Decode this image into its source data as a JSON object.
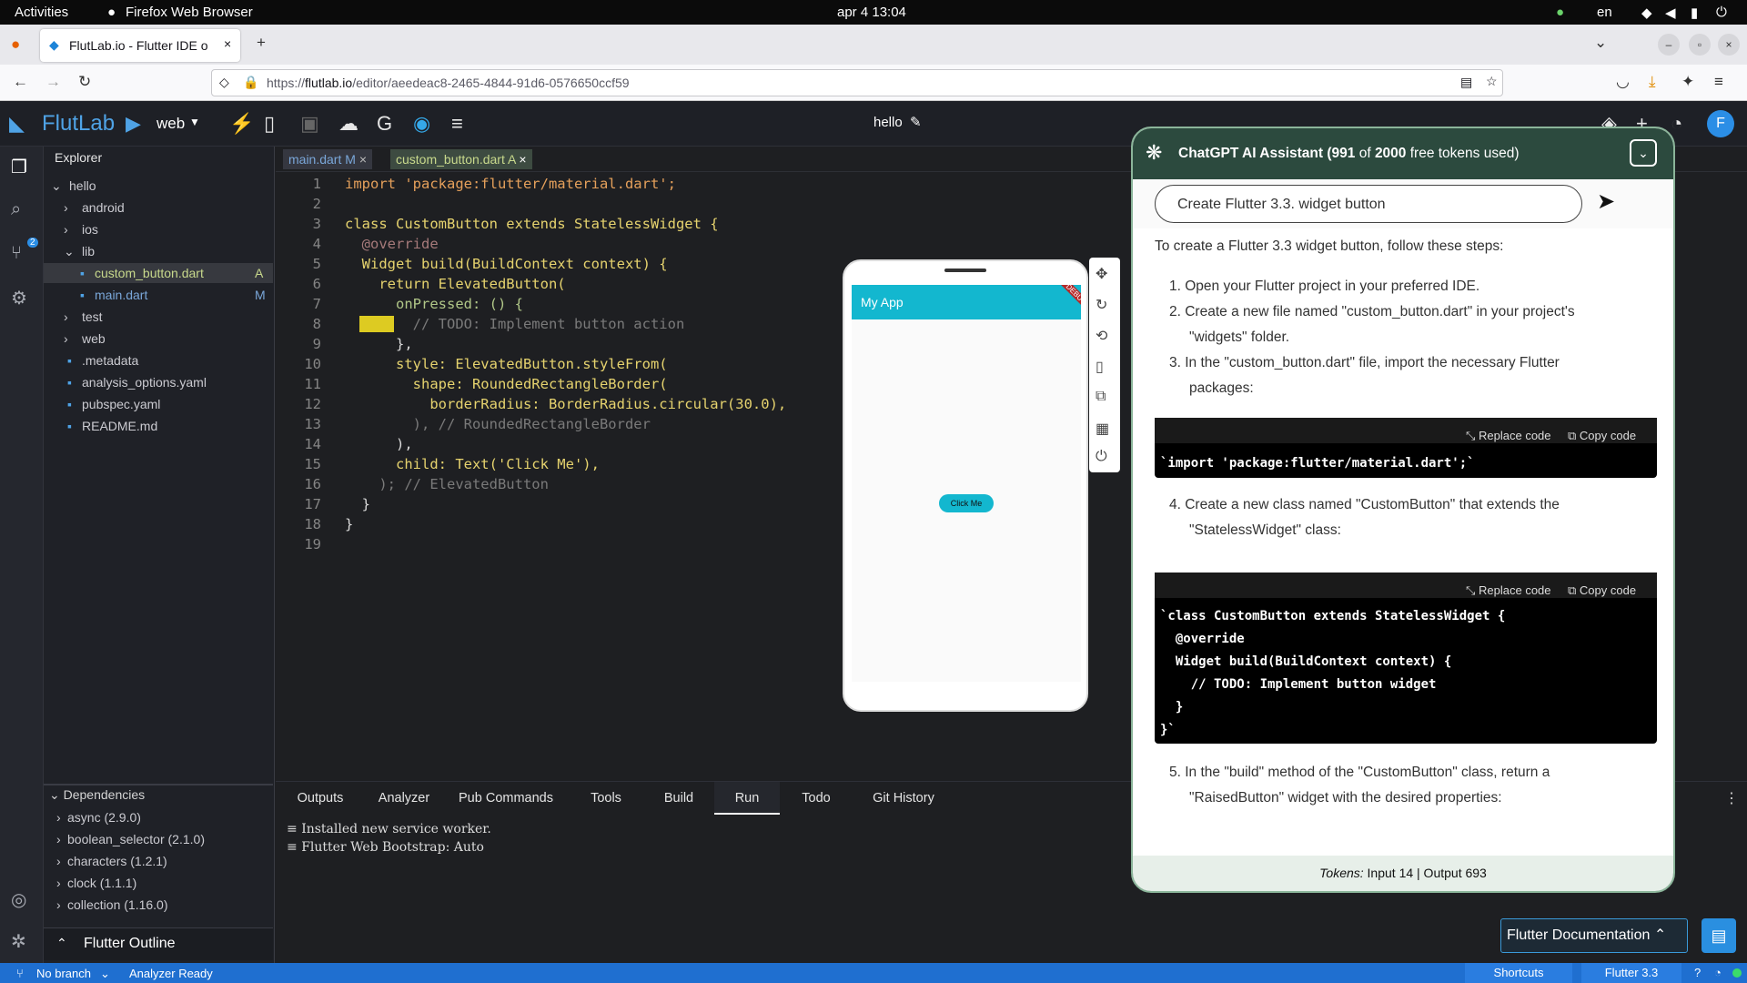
{
  "gnome": {
    "activities": "Activities",
    "app": "Firefox Web Browser",
    "clock": "apr 4  13:04",
    "lang": "en"
  },
  "browser": {
    "tab_title": "FlutLab.io - Flutter IDE o",
    "url_prefix": "https://",
    "url_host": "flutlab.io",
    "url_path": "/editor/aeedeac8-2465-4844-91d6-0576650ccf59"
  },
  "app": {
    "logo": "FlutLab",
    "target": "web",
    "project": "hello",
    "avatar": "F"
  },
  "explorer": {
    "title": "Explorer",
    "tree": [
      {
        "label": "hello",
        "depth": 0,
        "arrow": "v"
      },
      {
        "label": "android",
        "depth": 1,
        "arrow": ">"
      },
      {
        "label": "ios",
        "depth": 1,
        "arrow": ">"
      },
      {
        "label": "lib",
        "depth": 1,
        "arrow": "v"
      },
      {
        "label": "custom_button.dart",
        "depth": 2,
        "badge": "A",
        "selected": true
      },
      {
        "label": "main.dart",
        "depth": 2,
        "badge": "M"
      },
      {
        "label": "test",
        "depth": 1,
        "arrow": ">"
      },
      {
        "label": "web",
        "depth": 1,
        "arrow": ">"
      },
      {
        "label": ".metadata",
        "depth": 1
      },
      {
        "label": "analysis_options.yaml",
        "depth": 1
      },
      {
        "label": "pubspec.yaml",
        "depth": 1
      },
      {
        "label": "README.md",
        "depth": 1
      }
    ],
    "deps_title": "Dependencies",
    "deps": [
      "async (2.9.0)",
      "boolean_selector (2.1.0)",
      "characters (1.2.1)",
      "clock (1.1.1)",
      "collection (1.16.0)"
    ],
    "outline": "Flutter Outline"
  },
  "tabs": [
    {
      "label": "main.dart M"
    },
    {
      "label": "custom_button.dart A"
    }
  ],
  "code": [
    "import 'package:flutter/material.dart';",
    "",
    "class CustomButton extends StatelessWidget {",
    "  @override",
    "  Widget build(BuildContext context) {",
    "    return ElevatedButton(",
    "      onPressed: () {",
    "        // TODO: Implement button action",
    "      },",
    "      style: ElevatedButton.styleFrom(",
    "        shape: RoundedRectangleBorder(",
    "          borderRadius: BorderRadius.circular(30.0),",
    "        ), // RoundedRectangleBorder",
    "      ),",
    "      child: Text('Click Me'),",
    "    ); // ElevatedButton",
    "  }",
    "}",
    ""
  ],
  "preview": {
    "appbar": "My App",
    "debug": "DEBUG",
    "button": "Click Me"
  },
  "bottom": {
    "tabs": [
      "Outputs",
      "Analyzer",
      "Pub Commands",
      "Tools",
      "Build",
      "Run",
      "Todo",
      "Git History"
    ],
    "active": "Run",
    "log": [
      "Installed new service worker.",
      "Flutter Web Bootstrap: Auto"
    ]
  },
  "status": {
    "branch": "No branch",
    "analyzer": "Analyzer Ready",
    "shortcuts": "Shortcuts",
    "flutter": "Flutter 3.3"
  },
  "gpt": {
    "title_a": "ChatGPT AI Assistant (",
    "used": "991",
    "of": " of ",
    "total": "2000",
    "title_b": " free tokens used)",
    "input": "Create Flutter 3.3. widget button",
    "intro": "To create a Flutter 3.3 widget button, follow these steps:",
    "step1": "Open your Flutter project in your preferred IDE.",
    "step2a": "Create a new file named \"custom_button.dart\" in your project's",
    "step2b": "\"widgets\" folder.",
    "step3a": "In the \"custom_button.dart\" file, import the necessary Flutter",
    "step3b": "packages:",
    "replace": "Replace code",
    "copy": "Copy code",
    "code1": "`import 'package:flutter/material.dart';`",
    "step4a": "4. Create a new class named \"CustomButton\" that extends the",
    "step4b": "\"StatelessWidget\" class:",
    "code2": [
      "`class CustomButton extends StatelessWidget {",
      "  @override",
      "  Widget build(BuildContext context) {",
      "    // TODO: Implement button widget",
      "  }",
      "}`"
    ],
    "step5a": "5. In the \"build\" method of the \"CustomButton\" class, return a",
    "step5b": "\"RaisedButton\" widget with the desired properties:",
    "tokens_label": "Tokens:",
    "tokens_in": " Input 14 |",
    "tokens_out": " Output 693"
  },
  "docs": "Flutter Documentation"
}
